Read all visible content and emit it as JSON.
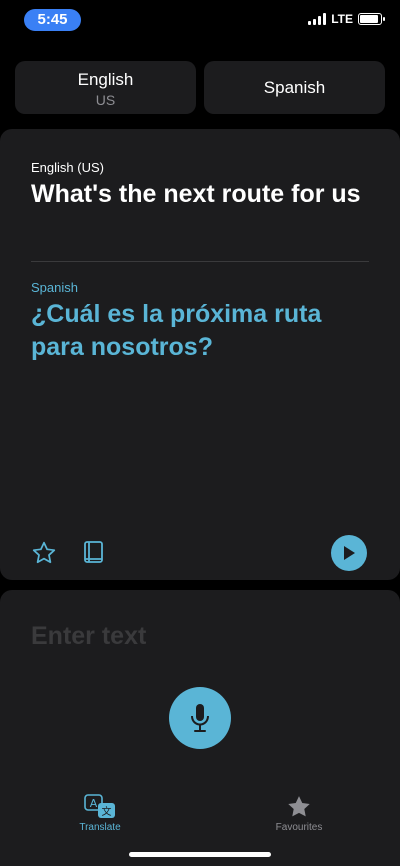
{
  "status_bar": {
    "time": "5:45",
    "network": "LTE",
    "time_pill_color": "#3a80f5",
    "signal_bars": 4,
    "battery_level": 0.9
  },
  "languages": {
    "source": {
      "name": "English",
      "region": "US"
    },
    "target": {
      "name": "Spanish"
    }
  },
  "translation": {
    "source_label": "English (US)",
    "source_text": "What's the next route for us",
    "target_label": "Spanish",
    "target_text": "¿Cuál es la próxima ruta para nosotros?",
    "accent_color": "#5ab5d6",
    "actions": [
      "star-icon",
      "book-icon",
      "play-icon"
    ]
  },
  "input": {
    "placeholder": "Enter text",
    "value": "",
    "mic_icon": "microphone-icon"
  },
  "tab_bar": {
    "tabs": [
      {
        "label": "Translate",
        "icon": "translate-icon",
        "active": true
      },
      {
        "label": "Favourites",
        "icon": "star-filled-icon",
        "active": false
      }
    ]
  }
}
